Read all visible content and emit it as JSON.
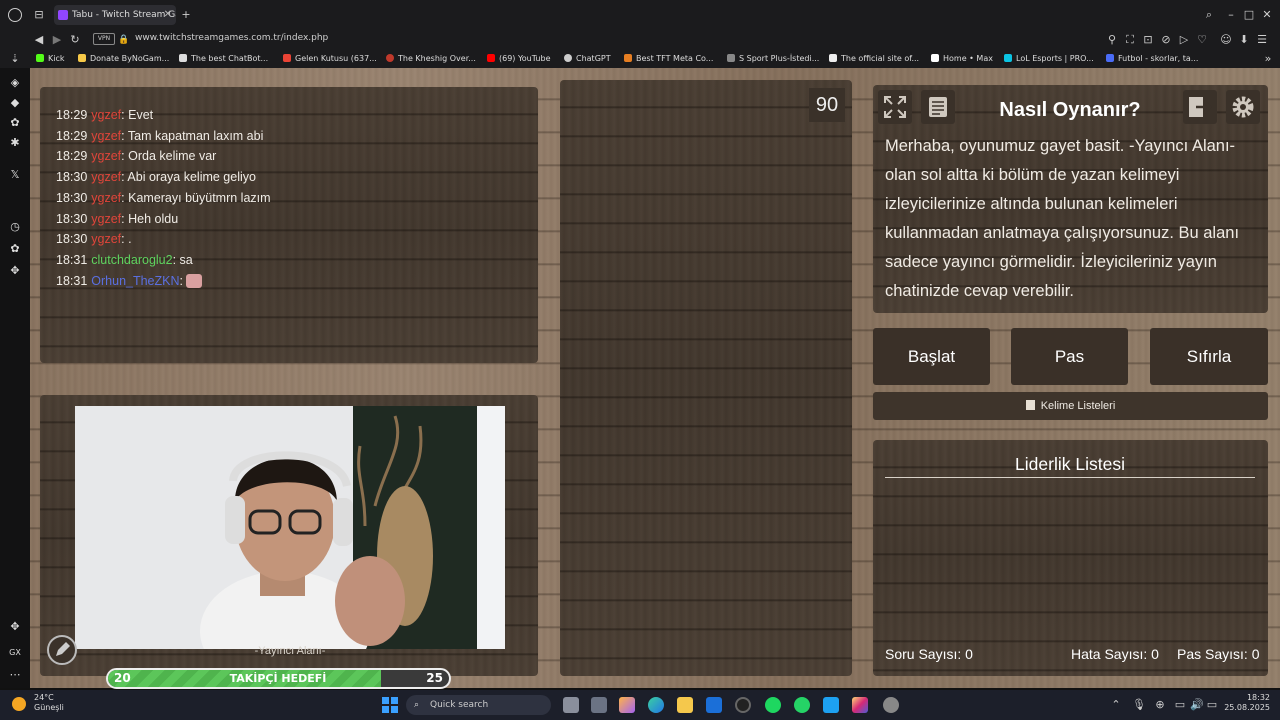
{
  "browser": {
    "tab_title": "Tabu - Twitch Stream Gam",
    "url": "www.twitchstreamgames.com.tr/index.php",
    "vpn_label": "VPN",
    "bookmarks": [
      {
        "label": "Kick",
        "color": "#53fc18"
      },
      {
        "label": "Donate ByNoGam...",
        "color": "#f7c948"
      },
      {
        "label": "The best ChatBot...",
        "color": "#dddddd"
      },
      {
        "label": "Gelen Kutusu (637...",
        "color": "#ea4335"
      },
      {
        "label": "The Kheshig Over...",
        "color": "#c0392b"
      },
      {
        "label": "(69) YouTube",
        "color": "#ff0000"
      },
      {
        "label": "ChatGPT",
        "color": "#cccccc"
      },
      {
        "label": "Best TFT Meta Co...",
        "color": "#e67e22"
      },
      {
        "label": "S Sport Plus-İstedi...",
        "color": "#888888"
      },
      {
        "label": "The official site of...",
        "color": "#eeeeee"
      },
      {
        "label": "Home • Max",
        "color": "#ffffff"
      },
      {
        "label": "LoL Esports | PRO...",
        "color": "#0bc4e3"
      },
      {
        "label": "Futbol - skorlar, ta...",
        "color": "#4a6cf7"
      }
    ]
  },
  "chat": {
    "messages": [
      {
        "time": "18:29",
        "user": "ygzef",
        "text": ": Evet",
        "color": "#e0453a"
      },
      {
        "time": "18:29",
        "user": "ygzef",
        "text": ": Tam kapatman laxım abi",
        "color": "#e0453a"
      },
      {
        "time": "18:29",
        "user": "ygzef",
        "text": ": Orda kelime var",
        "color": "#e0453a"
      },
      {
        "time": "18:30",
        "user": "ygzef",
        "text": ": Abi oraya kelime geliyo",
        "color": "#e0453a"
      },
      {
        "time": "18:30",
        "user": "ygzef",
        "text": ": Kamerayı büyütmrn lazım",
        "color": "#e0453a"
      },
      {
        "time": "18:30",
        "user": "ygzef",
        "text": ": Heh oldu",
        "color": "#e0453a"
      },
      {
        "time": "18:30",
        "user": "ygzef",
        "text": ": .",
        "color": "#e0453a"
      },
      {
        "time": "18:31",
        "user": "clutchdaroglu2",
        "text": ": sa",
        "color": "#5fd35f"
      },
      {
        "time": "18:31",
        "user": "Orhun_TheZKN",
        "text": ":",
        "color": "#5a6fe0"
      }
    ]
  },
  "game": {
    "timer": "90",
    "howto_title": "Nasıl Oynanır?",
    "howto_text": "Merhaba, oyunumuz gayet basit. -Yayıncı Alanı- olan sol altta ki bölüm de yazan kelimeyi izleyicilerinize altında bulunan kelimeleri kullanmadan anlatmaya çalışıyorsunuz. Bu alanı sadece yayıncı görmelidir. İzleyicileriniz yayın chatinizde cevap verebilir.",
    "start_label": "Başlat",
    "pass_label": "Pas",
    "reset_label": "Sıfırla",
    "word_lists_label": "Kelime Listeleri",
    "leaderboard_title": "Liderlik Listesi",
    "question_count_label": "Soru Sayısı: 0",
    "error_count_label": "Hata Sayısı: 0",
    "pass_count_label": "Pas Sayısı: 0"
  },
  "streamer_area": {
    "label": "-Yayıncı Alanı-"
  },
  "follower_goal": {
    "label": "TAKİPÇİ HEDEFİ",
    "current": "20",
    "target": "25",
    "progress": 0.8
  },
  "taskbar": {
    "temperature": "24°C",
    "weather": "Güneşli",
    "search_placeholder": "Quick search",
    "time": "18:32",
    "date": "25.08.2025"
  }
}
